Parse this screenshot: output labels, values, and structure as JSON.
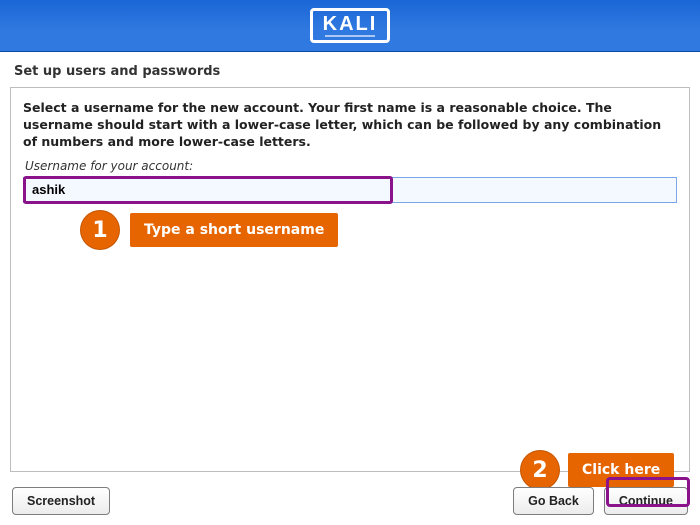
{
  "header": {
    "logo_text": "KALI"
  },
  "section_title": "Set up users and passwords",
  "main": {
    "instruction": "Select a username for the new account. Your first name is a reasonable choice. The username should start with a lower-case letter, which can be followed by any combination of numbers and more lower-case letters.",
    "field_label": "Username for your account:",
    "username_value": "ashik"
  },
  "callouts": {
    "c1": {
      "num": "1",
      "label": "Type a short username"
    },
    "c2": {
      "num": "2",
      "label": "Click here"
    }
  },
  "footer": {
    "screenshot": "Screenshot",
    "go_back": "Go Back",
    "continue": "Continue"
  }
}
